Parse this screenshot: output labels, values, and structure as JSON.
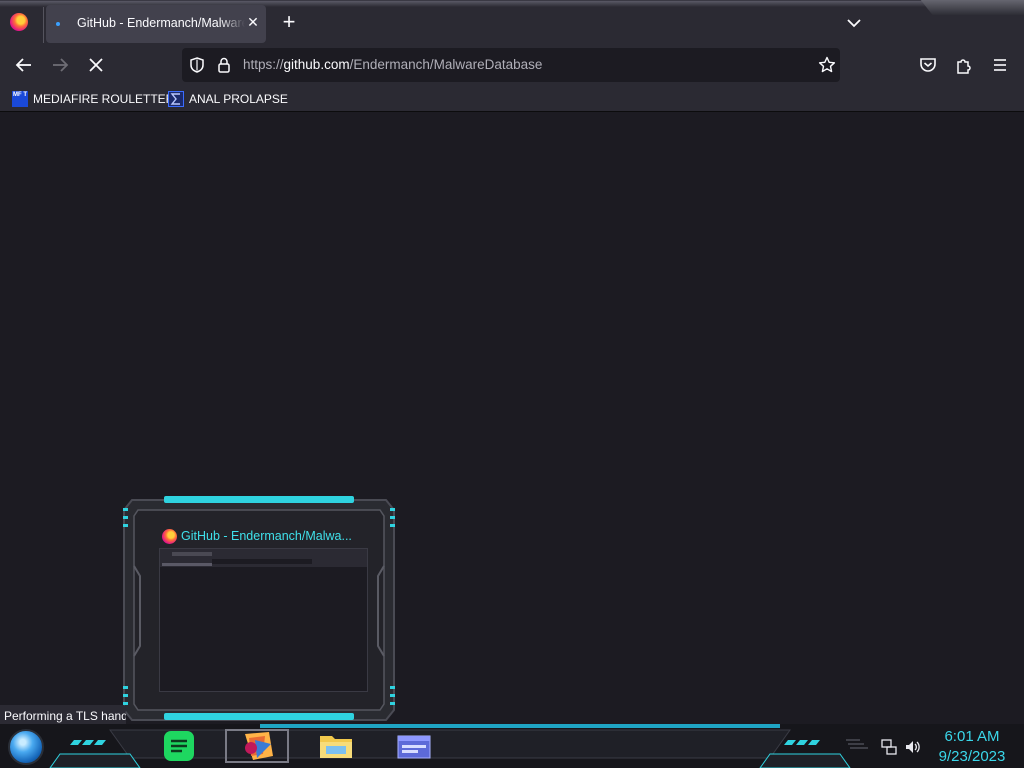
{
  "browser": {
    "tab": {
      "title": "GitHub - Endermanch/MalwareDatabase"
    },
    "url": {
      "prefix": "https://",
      "host": "github.com",
      "path": "/Endermanch/MalwareDatabase"
    },
    "bookmarks": [
      {
        "label": "MEDIAFIRE ROULETTER",
        "icon": "mediafire-icon",
        "icon_text": "MF T"
      },
      {
        "label": "ANAL PROLAPSE",
        "icon": "bookmark-sigma-icon"
      }
    ],
    "status_text": "Performing a TLS hand"
  },
  "taskbar": {
    "preview_title": "GitHub - Endermanch/Malwa...",
    "apps": [
      {
        "name": "spotify",
        "icon": "spotify-icon"
      },
      {
        "name": "firefox",
        "icon": "firefox-icon"
      },
      {
        "name": "file-explorer",
        "icon": "folder-icon"
      },
      {
        "name": "window-app",
        "icon": "window-app-icon"
      }
    ],
    "clock": {
      "time": "6:01 AM",
      "date": "9/23/2023"
    }
  },
  "colors": {
    "accent_cyan": "#3ad7ea",
    "chrome": "#2b2a33",
    "content": "#1c1b22"
  }
}
